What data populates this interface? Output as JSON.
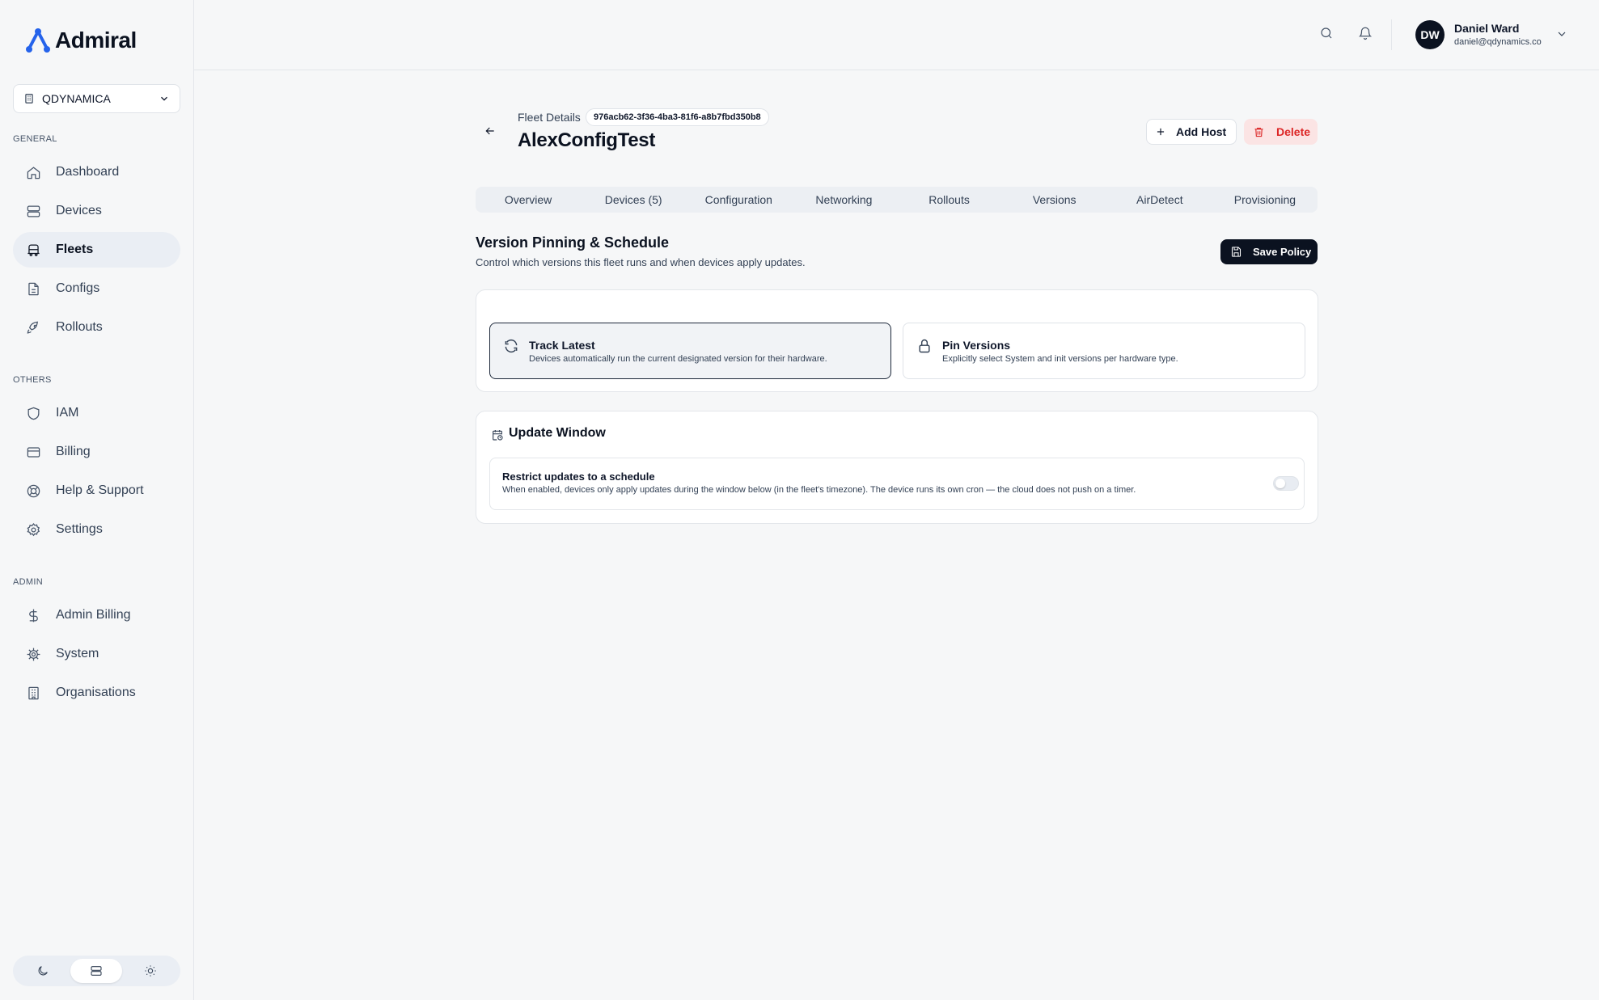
{
  "brand": {
    "name": "Admiral",
    "accent": "#2563eb",
    "primary": "#0b1220",
    "danger": "#dc2626"
  },
  "org_selector": {
    "value": "QDYNAMICA"
  },
  "sidebar": {
    "sections": [
      {
        "label": "GENERAL",
        "items": [
          {
            "label": "Dashboard",
            "icon": "home-icon"
          },
          {
            "label": "Devices",
            "icon": "server-icon"
          },
          {
            "label": "Fleets",
            "icon": "bus-icon",
            "active": true
          },
          {
            "label": "Configs",
            "icon": "file-icon"
          },
          {
            "label": "Rollouts",
            "icon": "rocket-icon"
          }
        ]
      },
      {
        "label": "OTHERS",
        "items": [
          {
            "label": "IAM",
            "icon": "shield-icon"
          },
          {
            "label": "Billing",
            "icon": "credit-card-icon"
          },
          {
            "label": "Help & Support",
            "icon": "lifebuoy-icon"
          },
          {
            "label": "Settings",
            "icon": "gear-icon"
          }
        ]
      },
      {
        "label": "ADMIN",
        "items": [
          {
            "label": "Admin Billing",
            "icon": "dollar-icon"
          },
          {
            "label": "System",
            "icon": "cog-icon"
          },
          {
            "label": "Organisations",
            "icon": "building-icon"
          }
        ]
      }
    ]
  },
  "user": {
    "initials": "DW",
    "name": "Daniel Ward",
    "email": "daniel@qdynamics.co"
  },
  "header": {
    "breadcrumb": "Fleet Details",
    "fleet_id": "976acb62-3f36-4ba3-81f6-a8b7fbd350b8",
    "title": "AlexConfigTest",
    "add_host_label": "Add Host",
    "delete_label": "Delete"
  },
  "tabs": [
    "Overview",
    "Devices (5)",
    "Configuration",
    "Networking",
    "Rollouts",
    "Versions",
    "AirDetect",
    "Provisioning"
  ],
  "section": {
    "title": "Version Pinning & Schedule",
    "description": "Control which versions this fleet runs and when devices apply updates.",
    "save_label": "Save Policy"
  },
  "options": [
    {
      "title": "Track Latest",
      "description": "Devices automatically run the current designated version for their hardware.",
      "selected": true
    },
    {
      "title": "Pin Versions",
      "description": "Explicitly select System and init versions per hardware type.",
      "selected": false
    }
  ],
  "update_window": {
    "title": "Update Window",
    "restrict_title": "Restrict updates to a schedule",
    "restrict_description": "When enabled, devices only apply updates during the window below (in the fleet's timezone). The device runs its own cron — the cloud does not push on a timer.",
    "enabled": false
  }
}
